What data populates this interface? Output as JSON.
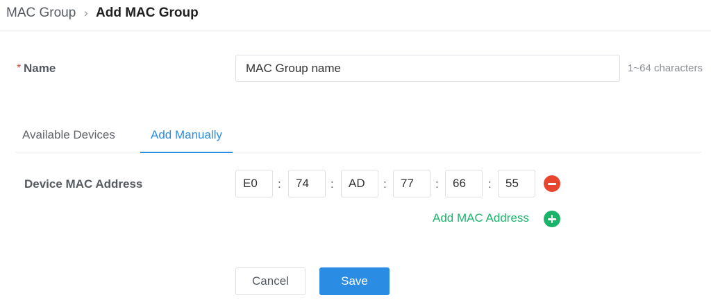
{
  "breadcrumb": {
    "parent": "MAC Group",
    "separator": "›",
    "current": "Add MAC Group"
  },
  "name_field": {
    "required_mark": "*",
    "label": "Name",
    "placeholder": "MAC Group name",
    "hint": "1~64 characters"
  },
  "tabs": [
    {
      "label": "Available Devices",
      "active": false
    },
    {
      "label": "Add Manually",
      "active": true
    }
  ],
  "mac_address": {
    "label": "Device MAC Address",
    "segments": [
      "E0",
      "74",
      "AD",
      "77",
      "66",
      "55"
    ],
    "separator": ":",
    "remove_icon": "minus-circle-icon",
    "add_label": "Add MAC Address",
    "add_icon": "plus-circle-icon"
  },
  "actions": {
    "cancel_label": "Cancel",
    "save_label": "Save"
  },
  "colors": {
    "accent": "#2a8ce2",
    "add_green": "#1cb36b",
    "remove_red": "#e8452f",
    "required_red": "#e64a3b"
  }
}
